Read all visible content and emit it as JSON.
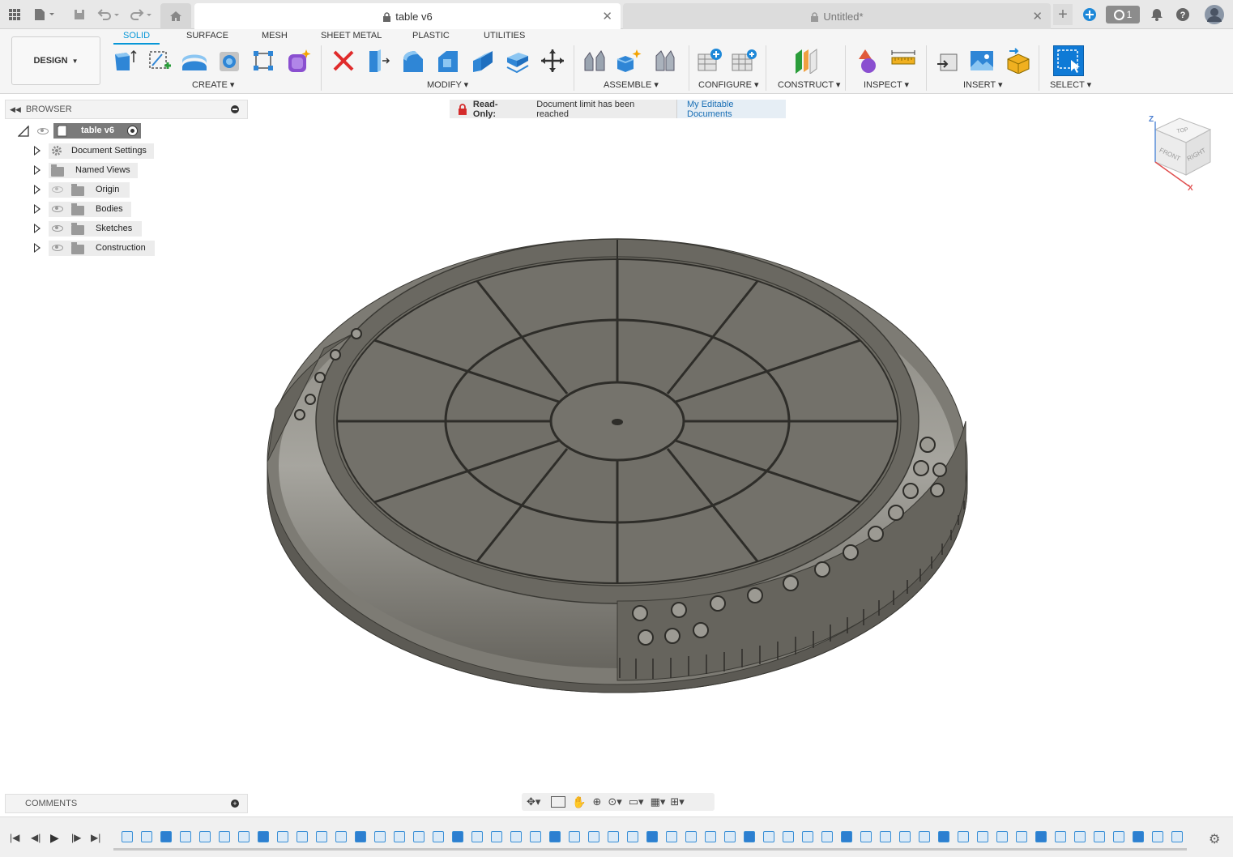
{
  "tabs": {
    "active_title": "table v6",
    "inactive_title": "Untitled*",
    "job_count": "1"
  },
  "ribbon": {
    "workspace": "DESIGN",
    "tabs": [
      "SOLID",
      "SURFACE",
      "MESH",
      "SHEET METAL",
      "PLASTIC",
      "UTILITIES"
    ],
    "groups": {
      "create": "CREATE",
      "modify": "MODIFY",
      "assemble": "ASSEMBLE",
      "configure": "CONFIGURE",
      "construct": "CONSTRUCT",
      "inspect": "INSPECT",
      "insert": "INSERT",
      "select": "SELECT"
    }
  },
  "browser": {
    "title": "BROWSER",
    "root": "table v6",
    "nodes": [
      "Document Settings",
      "Named Views",
      "Origin",
      "Bodies",
      "Sketches",
      "Construction"
    ]
  },
  "banner": {
    "label": "Read-Only:",
    "message": "Document limit has been reached",
    "link": "My Editable Documents"
  },
  "viewcube": {
    "top": "TOP",
    "front": "FRONT",
    "right": "RIGHT",
    "axis_z": "Z",
    "axis_x": "X"
  },
  "comments": {
    "title": "COMMENTS"
  },
  "colors": {
    "accent": "#0696d7",
    "model_face": "#6e6c64",
    "model_edge": "#3a3934"
  }
}
